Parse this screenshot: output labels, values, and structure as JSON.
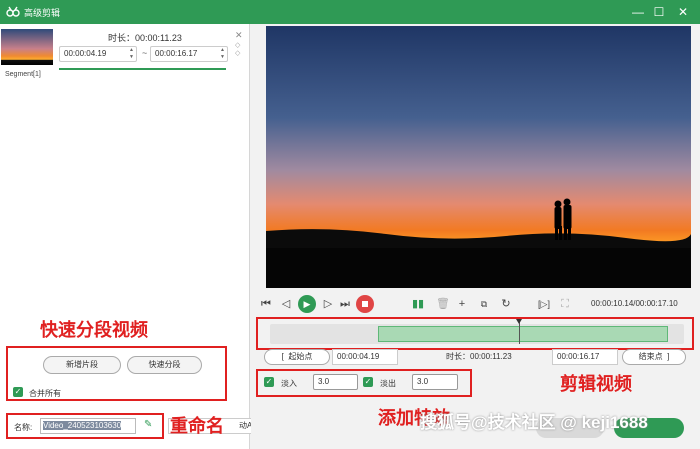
{
  "window": {
    "title": "高级剪辑",
    "minimize": "—",
    "maximize": "☐",
    "close": "✕"
  },
  "segment": {
    "label": "Segment[1]",
    "duration_label": "时长：00:00:11.23",
    "start": "00:00:04.19",
    "end": "00:00:16.17",
    "separator": "~",
    "close": "✕"
  },
  "quick": {
    "new_segment": "新增片段",
    "quick_segment": "快速分段",
    "merge_all": "合并所有"
  },
  "name": {
    "label": "名称:",
    "value": "Video_240523103630"
  },
  "output": {
    "value": "动Auto"
  },
  "player": {
    "time": "00:00:10.14/00:00:17.10"
  },
  "range": {
    "start_btn": "起始点",
    "start_value": "00:00:04.19",
    "duration": "时长：00:00:11.23",
    "end_value": "00:00:16.17",
    "end_btn": "结束点"
  },
  "fade": {
    "in_label": "淡入",
    "in_value": "3.0",
    "out_label": "淡出",
    "out_value": "3.0"
  },
  "annotations": {
    "quick_video": "快速分段视频",
    "rename": "重命名",
    "edit_video": "剪辑视频",
    "add_effect": "添加特效"
  },
  "watermark": "搜狐号@技术社区 @ keji1688",
  "buttons": {
    "ok": "",
    "cancel": ""
  },
  "colors": {
    "brand": "#2f9a55",
    "annotation": "#e02020",
    "stop": "#e04545"
  }
}
